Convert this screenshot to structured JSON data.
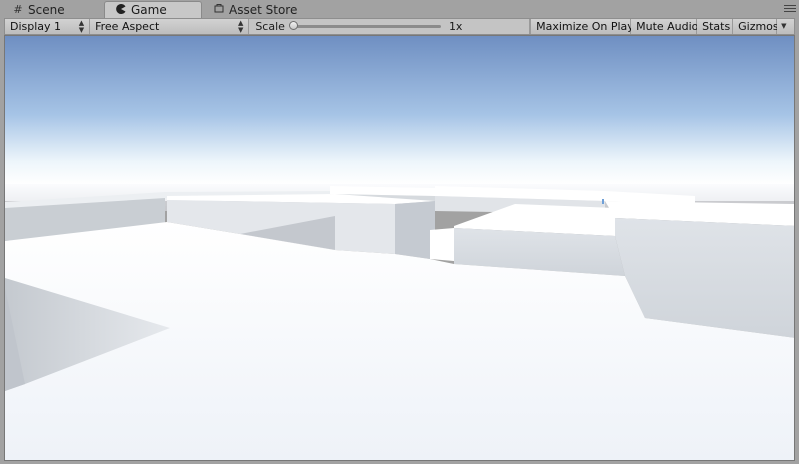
{
  "tabs": [
    {
      "label": "Scene",
      "icon": "grid-icon",
      "active": false
    },
    {
      "label": "Game",
      "icon": "pacman-icon",
      "active": true
    },
    {
      "label": "Asset Store",
      "icon": "bag-icon",
      "active": false
    }
  ],
  "toolbar": {
    "display_select": "Display 1",
    "aspect_select": "Free Aspect",
    "scale_label": "Scale",
    "scale_value": "1x",
    "scale_fraction": 0,
    "maximize_label": "Maximize On Play",
    "mute_label": "Mute Audio",
    "stats_label": "Stats",
    "gizmos_label": "Gizmos"
  },
  "colors": {
    "sky_top": "#6f8fc2",
    "horizon": "#ffffff",
    "ground": "#f4f7fb"
  }
}
